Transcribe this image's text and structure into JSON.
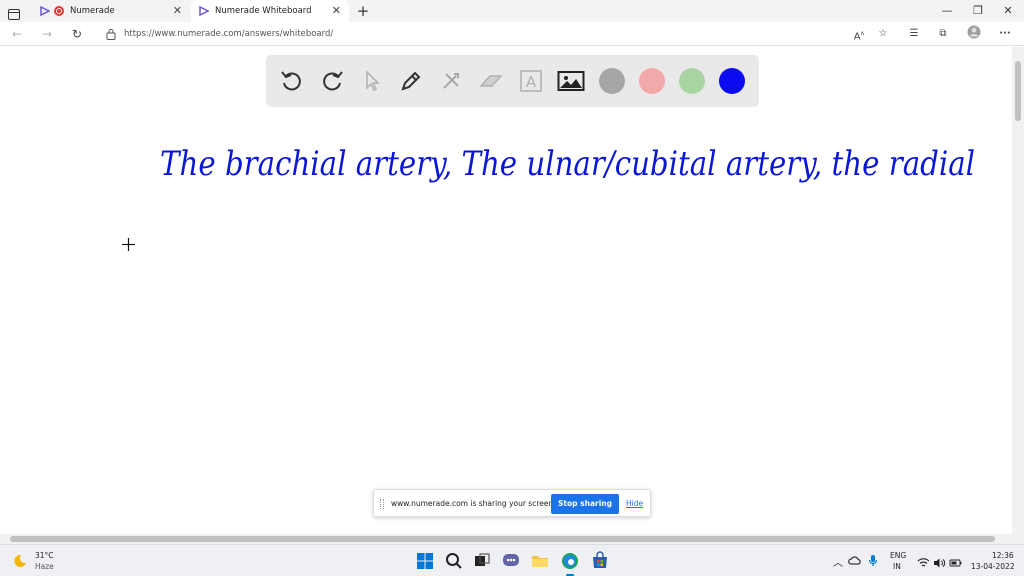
{
  "browser": {
    "tabs": [
      {
        "title": "Numerade"
      },
      {
        "title": "Numerade Whiteboard"
      }
    ],
    "url": "https://www.numerade.com/answers/whiteboard/"
  },
  "toolbar": {
    "tools": [
      "undo-icon",
      "redo-icon",
      "pointer-icon",
      "pen-icon",
      "tools-icon",
      "eraser-icon",
      "text-icon",
      "image-icon"
    ],
    "colors": [
      "#a6a6a6",
      "#f2a9a9",
      "#a8d5a2",
      "#0b0bf0"
    ]
  },
  "whiteboard": {
    "handwriting": "The brachial artery, The ulnar/cubital artery, the radial"
  },
  "share_banner": {
    "message": "www.numerade.com is sharing your screen.",
    "stop_label": "Stop sharing",
    "hide_label": "Hide"
  },
  "taskbar": {
    "weather_temp": "31°C",
    "weather_desc": "Haze",
    "lang_top": "ENG",
    "lang_bottom": "IN",
    "time": "12:36",
    "date": "13-04-2022"
  }
}
